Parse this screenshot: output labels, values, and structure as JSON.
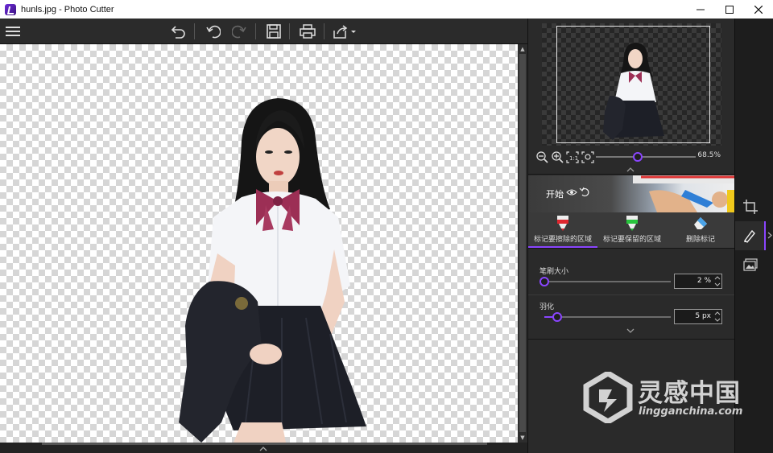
{
  "window": {
    "title": "hunls.jpg - Photo Cutter"
  },
  "toolbar": {
    "icons": [
      "menu-icon",
      "undo-all-icon",
      "undo-icon",
      "redo-icon",
      "save-icon",
      "print-icon",
      "share-icon"
    ]
  },
  "preview": {
    "zoom_value": "68.5%",
    "zoom_fraction": 0.42
  },
  "banner": {
    "label": "开始"
  },
  "modes": [
    {
      "label": "标记要擦除的区域",
      "color": "#e0262e",
      "active": true
    },
    {
      "label": "标记要保留的区域",
      "color": "#27c43c",
      "active": false
    },
    {
      "label": "删除标记",
      "color": "#4aa3e8",
      "active": false
    }
  ],
  "options": {
    "brush_size": {
      "label": "笔刷大小",
      "value": "2 %",
      "fraction": 0.0
    },
    "feather": {
      "label": "羽化",
      "value": "5 px",
      "fraction": 0.1
    }
  },
  "rail": {
    "icons": [
      "crop-icon",
      "brush-icon",
      "background-image-icon"
    ]
  },
  "watermark": {
    "cn": "灵感中国",
    "en": "lingganchina.com"
  },
  "colors": {
    "accent": "#8a45ff",
    "panel": "#2a2a2a",
    "toolbar": "#2b2b2b"
  }
}
